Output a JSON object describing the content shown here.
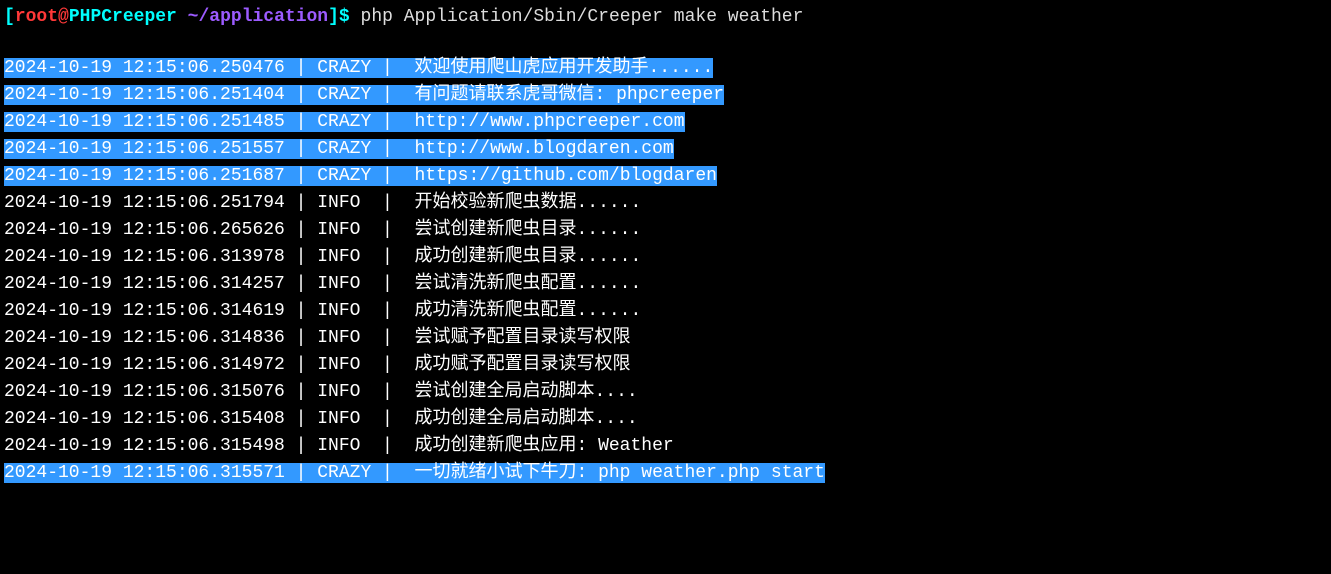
{
  "prompt": {
    "bracket_open": "[",
    "user": "root",
    "at": "@",
    "host": "PHPCreeper ",
    "tilde": "~",
    "path": "/application",
    "bracket_close": "]",
    "dollar": "$ ",
    "command": "php Application/Sbin/Creeper make weather"
  },
  "logs": [
    {
      "timestamp": "2024-10-19 12:15:06.250476",
      "level": "CRAZY",
      "message": "欢迎使用爬山虎应用开发助手......",
      "highlighted": true
    },
    {
      "timestamp": "2024-10-19 12:15:06.251404",
      "level": "CRAZY",
      "message": "有问题请联系虎哥微信: phpcreeper",
      "highlighted": true
    },
    {
      "timestamp": "2024-10-19 12:15:06.251485",
      "level": "CRAZY",
      "message": "http://www.phpcreeper.com",
      "highlighted": true
    },
    {
      "timestamp": "2024-10-19 12:15:06.251557",
      "level": "CRAZY",
      "message": "http://www.blogdaren.com",
      "highlighted": true
    },
    {
      "timestamp": "2024-10-19 12:15:06.251687",
      "level": "CRAZY",
      "message": "https://github.com/blogdaren",
      "highlighted": true
    },
    {
      "timestamp": "2024-10-19 12:15:06.251794",
      "level": "INFO ",
      "message": "开始校验新爬虫数据......",
      "highlighted": false
    },
    {
      "timestamp": "2024-10-19 12:15:06.265626",
      "level": "INFO ",
      "message": "尝试创建新爬虫目录......",
      "highlighted": false
    },
    {
      "timestamp": "2024-10-19 12:15:06.313978",
      "level": "INFO ",
      "message": "成功创建新爬虫目录......",
      "highlighted": false
    },
    {
      "timestamp": "2024-10-19 12:15:06.314257",
      "level": "INFO ",
      "message": "尝试清洗新爬虫配置......",
      "highlighted": false
    },
    {
      "timestamp": "2024-10-19 12:15:06.314619",
      "level": "INFO ",
      "message": "成功清洗新爬虫配置......",
      "highlighted": false
    },
    {
      "timestamp": "2024-10-19 12:15:06.314836",
      "level": "INFO ",
      "message": "尝试赋予配置目录读写权限",
      "highlighted": false
    },
    {
      "timestamp": "2024-10-19 12:15:06.314972",
      "level": "INFO ",
      "message": "成功赋予配置目录读写权限",
      "highlighted": false
    },
    {
      "timestamp": "2024-10-19 12:15:06.315076",
      "level": "INFO ",
      "message": "尝试创建全局启动脚本....",
      "highlighted": false
    },
    {
      "timestamp": "2024-10-19 12:15:06.315408",
      "level": "INFO ",
      "message": "成功创建全局启动脚本....",
      "highlighted": false
    },
    {
      "timestamp": "2024-10-19 12:15:06.315498",
      "level": "INFO ",
      "message": "成功创建新爬虫应用: Weather",
      "highlighted": false
    },
    {
      "timestamp": "2024-10-19 12:15:06.315571",
      "level": "CRAZY",
      "message": "一切就绪小试下牛刀: php weather.php start",
      "highlighted": true
    }
  ]
}
